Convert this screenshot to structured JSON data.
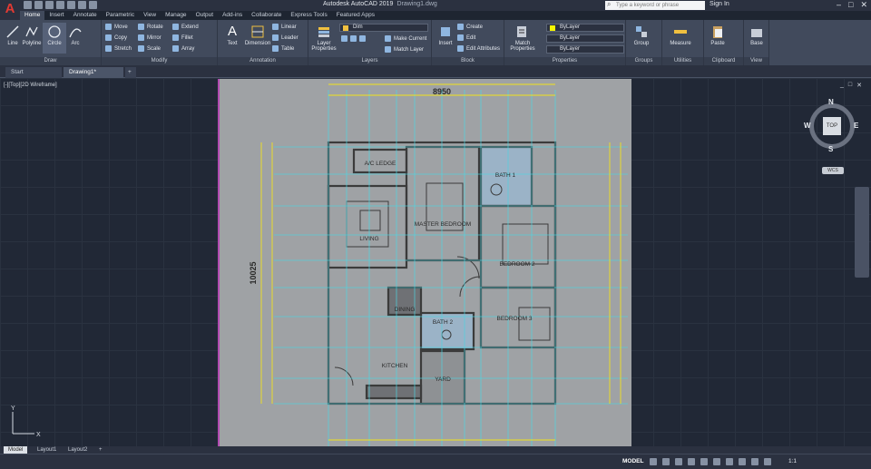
{
  "app": {
    "title": "Autodesk AutoCAD 2019",
    "document": "Drawing1.dwg",
    "search_placeholder": "Type a keyword or phrase",
    "signin": "Sign In"
  },
  "ribbon_tabs": [
    "Home",
    "Insert",
    "Annotate",
    "Parametric",
    "View",
    "Manage",
    "Output",
    "Add-ins",
    "Collaborate",
    "Express Tools",
    "Featured Apps"
  ],
  "draw": {
    "title": "Draw",
    "line": "Line",
    "polyline": "Polyline",
    "circle": "Circle",
    "arc": "Arc"
  },
  "modify": {
    "title": "Modify",
    "move": "Move",
    "rotate": "Rotate",
    "extend": "Extend",
    "copy": "Copy",
    "mirror": "Mirror",
    "fillet": "Fillet",
    "stretch": "Stretch",
    "scale": "Scale",
    "array": "Array"
  },
  "annotation": {
    "title": "Annotation",
    "text": "Text",
    "dimension": "Dimension",
    "linear": "Linear",
    "leader": "Leader",
    "table": "Table"
  },
  "layers": {
    "title": "Layers",
    "layer_properties": "Layer Properties",
    "current_layer": "Dim",
    "make_current": "Make Current",
    "match_layer": "Match Layer"
  },
  "block": {
    "title": "Block",
    "insert": "Insert",
    "create": "Create",
    "edit": "Edit",
    "edit_attributes": "Edit Attributes"
  },
  "properties": {
    "title": "Properties",
    "match": "Match Properties",
    "color": "ByLayer",
    "linetype": "ByLayer",
    "lineweight": "ByLayer"
  },
  "groups": {
    "title": "Groups",
    "group": "Group"
  },
  "utilities": {
    "title": "Utilities",
    "measure": "Measure"
  },
  "clipboard": {
    "title": "Clipboard",
    "paste": "Paste"
  },
  "view": {
    "title": "View",
    "base": "Base"
  },
  "doc_tabs": {
    "start": "Start",
    "drawing": "Drawing1*"
  },
  "viewport": {
    "label": "[-][Top][2D Wireframe]",
    "controls": [
      "_",
      "□",
      "✕"
    ]
  },
  "plan": {
    "overall_width": "8950",
    "overall_height": "10025",
    "rooms": [
      "A/C LEDGE",
      "BATH 1",
      "MASTER BEDROOM",
      "LIVING",
      "BEDROOM 2",
      "DINING",
      "BATH 2",
      "BEDROOM 3",
      "KITCHEN",
      "YARD"
    ]
  },
  "viewcube": {
    "north": "N",
    "south": "S",
    "east": "E",
    "west": "W",
    "face": "TOP",
    "wcs": "WCS"
  },
  "layout_tabs": {
    "model": "Model",
    "layout1": "Layout1",
    "layout2": "Layout2"
  },
  "status": {
    "mode": "MODEL",
    "scale": "1:1"
  }
}
